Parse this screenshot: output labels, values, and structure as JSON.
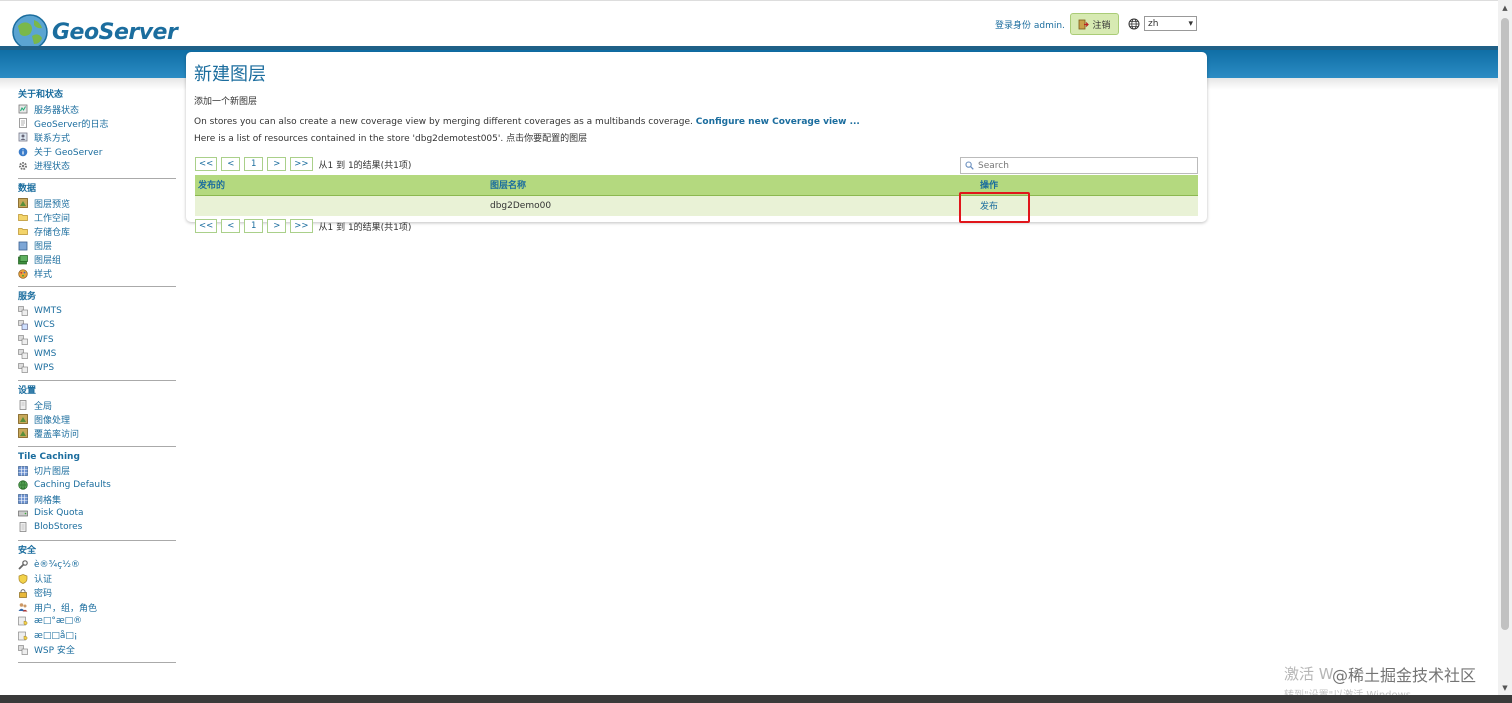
{
  "header": {
    "logo_text": "GeoServer",
    "login_info": "登录身份 admin.",
    "logout_label": "注销",
    "language": "zh"
  },
  "sidebar": {
    "sections": [
      {
        "title": "关于和状态",
        "items": [
          {
            "label": "服务器状态",
            "icon": "server-status-icon"
          },
          {
            "label": "GeoServer的日志",
            "icon": "log-icon"
          },
          {
            "label": "联系方式",
            "icon": "contact-icon"
          },
          {
            "label": "关于 GeoServer",
            "icon": "about-icon"
          },
          {
            "label": "进程状态",
            "icon": "process-icon"
          }
        ]
      },
      {
        "title": "数据",
        "items": [
          {
            "label": "图层预览",
            "icon": "layer-preview-icon"
          },
          {
            "label": "工作空间",
            "icon": "workspace-folder-icon"
          },
          {
            "label": "存储仓库",
            "icon": "store-folder-icon"
          },
          {
            "label": "图层",
            "icon": "layers-icon"
          },
          {
            "label": "图层组",
            "icon": "layer-group-icon"
          },
          {
            "label": "样式",
            "icon": "style-icon"
          }
        ]
      },
      {
        "title": "服务",
        "items": [
          {
            "label": "WMTS",
            "icon": "wmts-icon"
          },
          {
            "label": "WCS",
            "icon": "wcs-icon"
          },
          {
            "label": "WFS",
            "icon": "wfs-icon"
          },
          {
            "label": "WMS",
            "icon": "wms-icon"
          },
          {
            "label": "WPS",
            "icon": "wps-icon"
          }
        ]
      },
      {
        "title": "设置",
        "items": [
          {
            "label": "全局",
            "icon": "global-icon"
          },
          {
            "label": "图像处理",
            "icon": "image-processing-icon"
          },
          {
            "label": "覆盖率访问",
            "icon": "coverage-access-icon"
          }
        ]
      },
      {
        "title": "Tile Caching",
        "items": [
          {
            "label": "切片图层",
            "icon": "tile-layers-icon"
          },
          {
            "label": "Caching Defaults",
            "icon": "caching-defaults-icon"
          },
          {
            "label": "网格集",
            "icon": "gridsets-icon"
          },
          {
            "label": "Disk Quota",
            "icon": "disk-quota-icon"
          },
          {
            "label": "BlobStores",
            "icon": "blobstores-icon"
          }
        ]
      },
      {
        "title": "安全",
        "items": [
          {
            "label": "è®¾ç½®",
            "icon": "wrench-icon"
          },
          {
            "label": "认证",
            "icon": "shield-icon"
          },
          {
            "label": "密码",
            "icon": "lock-icon"
          },
          {
            "label": "用户，组，角色",
            "icon": "users-icon"
          },
          {
            "label": "æ□°æ□®",
            "icon": "data-security-icon"
          },
          {
            "label": "æ□□å□¡",
            "icon": "service-security-icon"
          },
          {
            "label": "WSP 安全",
            "icon": "wps-security-icon"
          }
        ]
      }
    ]
  },
  "main": {
    "title": "新建图层",
    "subtitle": "添加一个新图层",
    "desc_line_1_prefix": "On stores you can also create a new coverage view by merging different coverages as a multibands coverage.",
    "desc_line_1_link": "Configure new Coverage view ...",
    "desc_line_2": "Here is a list of resources contained in the store 'dbg2demotest005'. 点击你要配置的图层",
    "pager": {
      "first": "<<",
      "prev": "<",
      "page": "1",
      "next": ">",
      "last": ">>",
      "info": "从1 到 1的结果(共1项)"
    },
    "search_placeholder": "Search",
    "table": {
      "headers": [
        "发布的",
        "图层名称",
        "操作"
      ],
      "rows": [
        {
          "published": "",
          "layer_name": "dbg2Demo00",
          "action": "发布"
        }
      ]
    }
  },
  "watermark": {
    "line1": "激活 W",
    "line2": "转到\"设置\"以激活 Windows。",
    "overlay": "@稀土掘金技术社区"
  }
}
